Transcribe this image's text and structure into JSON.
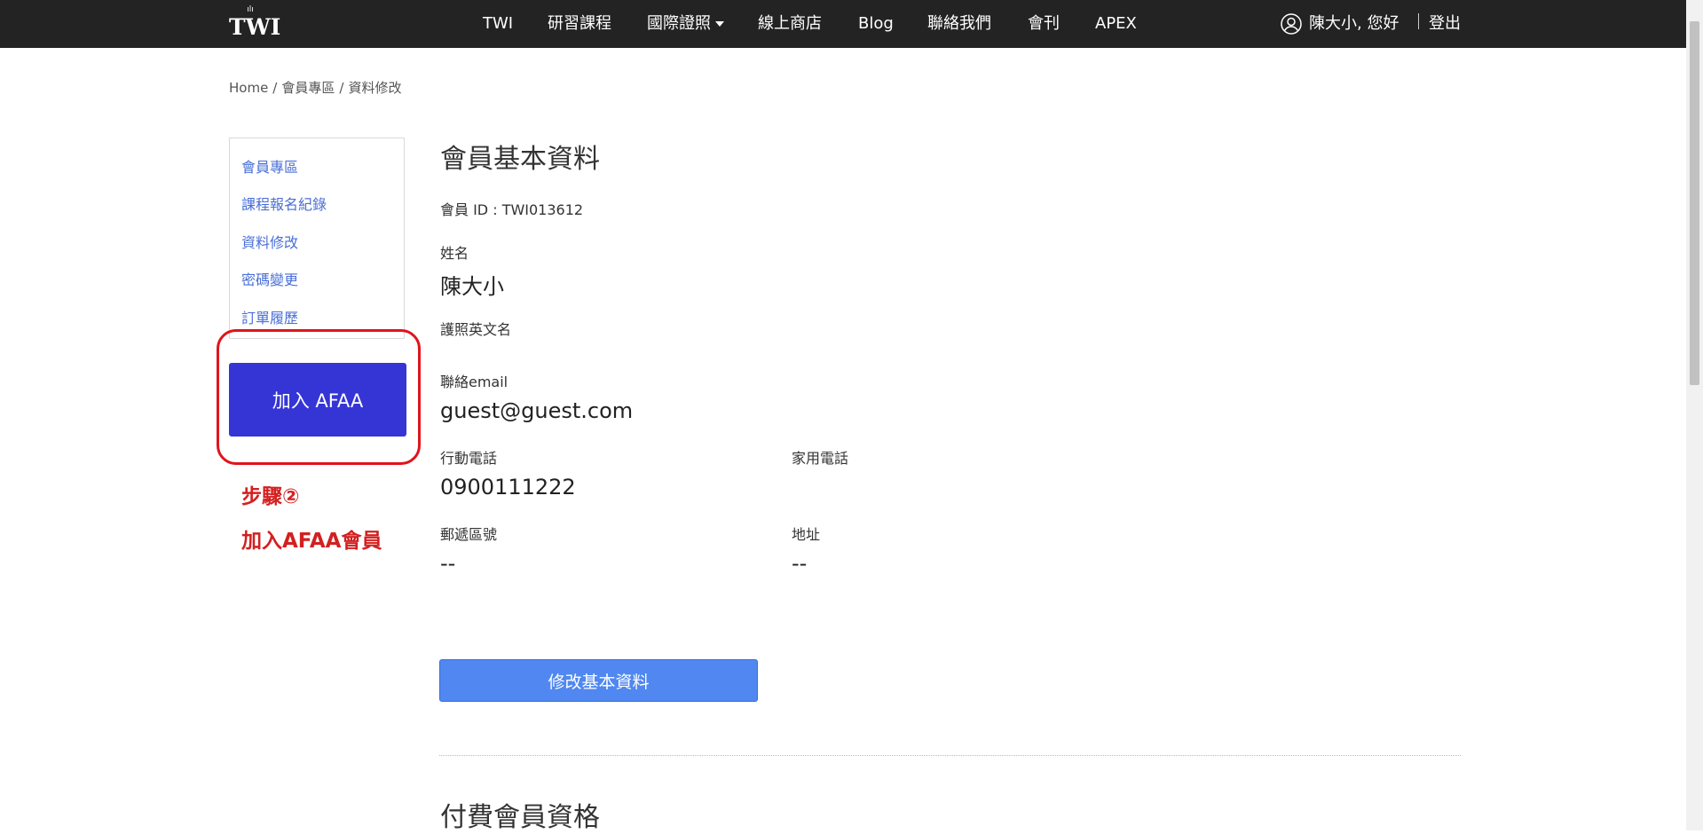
{
  "nav": {
    "logo_text": "TWI",
    "items": [
      "TWI",
      "研習課程",
      "國際證照",
      "線上商店",
      "Blog",
      "聯絡我們",
      "會刊",
      "APEX"
    ],
    "user_greeting": "陳大小, 您好",
    "logout_label": "登出"
  },
  "breadcrumb": [
    "Home",
    "會員專區",
    "資料修改"
  ],
  "sidebar": {
    "items": [
      "會員專區",
      "課程報名紀錄",
      "資料修改",
      "密碼變更",
      "訂單履歷"
    ],
    "join_button_label": "加入 AFAA"
  },
  "annotation": {
    "line1": "步驟②",
    "line2": "加入AFAA會員",
    "color": "#e0141c"
  },
  "profile": {
    "title": "會員基本資料",
    "member_id_text": "會員 ID : TWI013612",
    "name_label": "姓名",
    "name_value": "陳大小",
    "passport_label": "護照英文名",
    "passport_value": "",
    "email_label": "聯絡email",
    "email_value": "guest@guest.com",
    "mobile_label": "行動電話",
    "mobile_value": "0900111222",
    "home_phone_label": "家用電話",
    "home_phone_value": "",
    "zip_label": "郵遞區號",
    "zip_value": "--",
    "address_label": "地址",
    "address_value": "--",
    "edit_button_label": "修改基本資料"
  },
  "paid_member": {
    "title": "付費會員資格"
  },
  "colors": {
    "nav_bg": "#232323",
    "link": "#4a6fd6",
    "afaa_button": "#3535d6",
    "edit_button": "#5087f0",
    "annotation": "#e0141c"
  }
}
